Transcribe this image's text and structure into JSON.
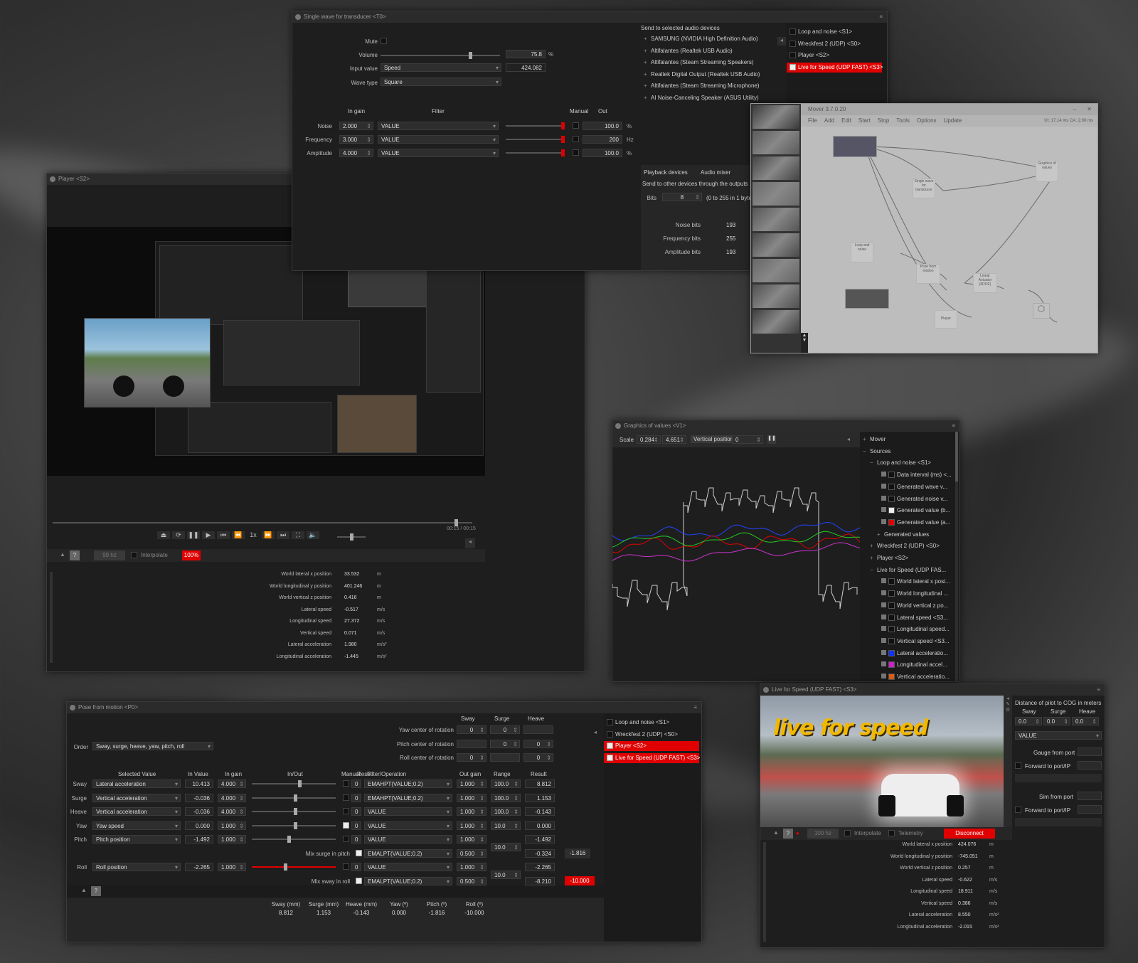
{
  "colors": {
    "accent_red": "#e10000",
    "panel": "#1e1e1e",
    "title": "#2b2b2b"
  },
  "wave": {
    "title": "Single wave for transducer <T0>",
    "mute": "Mute",
    "volume_label": "Volume",
    "volume_value": "75.8",
    "volume_unit": "%",
    "volume_level": 0.758,
    "input_label": "Input value",
    "input_value": "Speed",
    "input_readout": "424.082",
    "wavetype_label": "Wave type",
    "wavetype_value": "Square",
    "cols": {
      "ingain": "In gain",
      "filter": "Filter",
      "manual": "Manual",
      "out": "Out"
    },
    "rows": [
      {
        "label": "Noise",
        "gain": "2.000",
        "filter": "VALUE",
        "out": "100.0",
        "unit": "%"
      },
      {
        "label": "Frequency",
        "gain": "3.000",
        "filter": "VALUE",
        "out": "200",
        "unit": "Hz"
      },
      {
        "label": "Amplitude",
        "gain": "4.000",
        "filter": "VALUE",
        "out": "100.0",
        "unit": "%"
      }
    ],
    "send_title": "Send to selected audio devices",
    "devices": [
      "SAMSUNG (NVIDIA High Definition Audio)",
      "Altifalantes (Realtek USB Audio)",
      "Altifalantes (Steam Streaming Speakers)",
      "Realtek Digital Output (Realtek USB Audio)",
      "Altifalantes (Steam Streaming Microphone)",
      "AI Noise-Canceling Speaker (ASUS Utility)"
    ],
    "tabs": [
      "Playback devices",
      "Audio mixer"
    ],
    "send_other": "Send to other devices through the outputs",
    "bits_label": "Bits",
    "bits_value": "8",
    "bits_hint": "(0 to 255 in 1 byte)",
    "bitrows": [
      {
        "label": "Noise bits",
        "value": "193"
      },
      {
        "label": "Frequency bits",
        "value": "255"
      },
      {
        "label": "Amplitude bits",
        "value": "193"
      }
    ],
    "sources": [
      "Loop and noise <S1>",
      "Wreckfest 2 (UDP) <S0>",
      "Player <S2>",
      "Live for Speed (UDP FAST) <S3>"
    ]
  },
  "player": {
    "title": "Player <S2>",
    "hz": "99 hz",
    "interpolate": "Interpolate",
    "pct": "100%",
    "time": "00:15 / 00:15",
    "stats": [
      {
        "label": "World lateral x position",
        "value": "33.532",
        "unit": "m"
      },
      {
        "label": "World longitudinal y position",
        "value": "401.246",
        "unit": "m"
      },
      {
        "label": "World vertical z position",
        "value": "0.416",
        "unit": "m"
      },
      {
        "label": "Lateral speed",
        "value": "-0.517",
        "unit": "m/s"
      },
      {
        "label": "Longitudinal speed",
        "value": "27.372",
        "unit": "m/s"
      },
      {
        "label": "Vertical speed",
        "value": "0.071",
        "unit": "m/s"
      },
      {
        "label": "Lateral acceleration",
        "value": "1.980",
        "unit": "m/s²"
      },
      {
        "label": "Longitudinal acceleration",
        "value": "-1.445",
        "unit": "m/s²"
      }
    ]
  },
  "mover": {
    "title": "Mover 3.7.0.20",
    "menu": [
      "File",
      "Add",
      "Edit",
      "Start",
      "Stop",
      "Tools",
      "Options",
      "Update"
    ],
    "status": "Ut: 17.14 ms  CA: 2.00 ms",
    "nodes": [
      "Single wave for transducer",
      "Graphics of values",
      "Loop and noise",
      "Pose from motion",
      "Linear Actuator (6DOF)",
      "Player"
    ]
  },
  "graph": {
    "title": "Graphics of values <V1>",
    "scale_label": "Scale",
    "scale_a": "0.284",
    "scale_b": "4.651",
    "vpos_label": "Vertical position",
    "vpos_value": "0",
    "tree": [
      {
        "text": "Mover",
        "lvl": 0,
        "sign": "+"
      },
      {
        "text": "Sources",
        "lvl": 0,
        "sign": "−"
      },
      {
        "text": "Loop and noise <S1>",
        "lvl": 1,
        "sign": "−"
      },
      {
        "text": "Data interval (ms) <...",
        "lvl": 2,
        "color": "#111"
      },
      {
        "text": "Generated wave v...",
        "lvl": 2,
        "color": "#111"
      },
      {
        "text": "Generated noise v...",
        "lvl": 2,
        "color": "#111"
      },
      {
        "text": "Generated value (b...",
        "lvl": 2,
        "color": "#eeeeee"
      },
      {
        "text": "Generated value (a...",
        "lvl": 2,
        "color": "#e10000"
      },
      {
        "text": "Generated values",
        "lvl": 2,
        "sign": "+"
      },
      {
        "text": "Wreckfest 2 (UDP) <S0>",
        "lvl": 1,
        "sign": "+"
      },
      {
        "text": "Player <S2>",
        "lvl": 1,
        "sign": "+"
      },
      {
        "text": "Live for Speed (UDP FAS...",
        "lvl": 1,
        "sign": "−"
      },
      {
        "text": "World lateral x posi...",
        "lvl": 2,
        "color": "#111"
      },
      {
        "text": "World longitudinal ...",
        "lvl": 2,
        "color": "#111"
      },
      {
        "text": "World vertical z po...",
        "lvl": 2,
        "color": "#111"
      },
      {
        "text": "Lateral speed <S3...",
        "lvl": 2,
        "color": "#111"
      },
      {
        "text": "Longitudinal speed...",
        "lvl": 2,
        "color": "#111"
      },
      {
        "text": "Vertical speed <S3...",
        "lvl": 2,
        "color": "#111"
      },
      {
        "text": "Lateral acceleratio...",
        "lvl": 2,
        "color": "#1133ff"
      },
      {
        "text": "Longitudinal accel...",
        "lvl": 2,
        "color": "#cc22cc"
      },
      {
        "text": "Vertical acceleratio...",
        "lvl": 2,
        "color": "#e06010"
      }
    ]
  },
  "pose": {
    "title": "Pose from motion <P0>",
    "order_label": "Order",
    "order_value": "Sway, surge, heave, yaw, pitch, roll",
    "center_cols": [
      "Sway",
      "Surge",
      "Heave"
    ],
    "centers": [
      {
        "label": "Yaw center of rotation",
        "vals": [
          "0",
          "0",
          ""
        ]
      },
      {
        "label": "Pitch center of rotation",
        "vals": [
          "",
          "0",
          "0"
        ]
      },
      {
        "label": "Roll center of rotation",
        "vals": [
          "0",
          "",
          "0"
        ]
      }
    ],
    "cols": [
      "Selected Value",
      "In Value",
      "In gain",
      "In/Out",
      "Manual",
      "Reset",
      "Filter/Operation",
      "Out gain",
      "Range",
      "Result"
    ],
    "rows": [
      {
        "axis": "Sway",
        "sel": "Lateral acceleration",
        "inval": "10.413",
        "gain": "4.000",
        "reset": "0",
        "filter": "EMAHPT(VALUE;0.2)",
        "outgain": "1.000",
        "range": "100.0",
        "result": "8.812"
      },
      {
        "axis": "Surge",
        "sel": "Vertical acceleration",
        "inval": "-0.036",
        "gain": "4.000",
        "reset": "0",
        "filter": "EMAHPT(VALUE;0.2)",
        "outgain": "1.000",
        "range": "100.0",
        "result": "1.153"
      },
      {
        "axis": "Heave",
        "sel": "Vertical acceleration",
        "inval": "-0.036",
        "gain": "4.000",
        "reset": "0",
        "filter": "VALUE",
        "outgain": "1.000",
        "range": "100.0",
        "result": "-0.143"
      },
      {
        "axis": "Yaw",
        "sel": "Yaw speed",
        "inval": "0.000",
        "gain": "1.000",
        "reset": "0",
        "filter": "VALUE",
        "outgain": "1.000",
        "range": "10.0",
        "result": "0.000"
      },
      {
        "axis": "Pitch",
        "sel": "Pitch position",
        "inval": "-1.492",
        "gain": "1.000",
        "reset": "0",
        "filter": "VALUE",
        "outgain": "1.000",
        "range": "",
        "result": "-1.492"
      },
      {
        "axis": "",
        "sel": "Mix surge in pitch",
        "inval": "",
        "gain": "",
        "reset": "",
        "filter": "EMALPT(VALUE;0.2)",
        "outgain": "0.500",
        "range": "10.0",
        "result": "-0.324"
      },
      {
        "axis": "Roll",
        "sel": "Roll position",
        "inval": "-2.265",
        "gain": "1.000",
        "reset": "0",
        "filter": "VALUE",
        "outgain": "1.000",
        "range": "",
        "result": "-2.265"
      },
      {
        "axis": "",
        "sel": "Mix sway in roll",
        "inval": "",
        "gain": "",
        "reset": "",
        "filter": "EMALPT(VALUE;0.2)",
        "outgain": "0.500",
        "range": "10.0",
        "result": "-8.210"
      }
    ],
    "pitch_total": "-1.816",
    "roll_total": "-10.000",
    "sources": [
      "Loop and noise <S1>",
      "Wreckfest 2 (UDP) <S0>",
      "Player <S2>",
      "Live for Speed (UDP FAST) <S3>"
    ],
    "summary": [
      {
        "label": "Sway (mm)",
        "value": "8.812"
      },
      {
        "label": "Surge (mm)",
        "value": "1.153"
      },
      {
        "label": "Heave (mm)",
        "value": "-0.143"
      },
      {
        "label": "Yaw (º)",
        "value": "0.000"
      },
      {
        "label": "Pitch (º)",
        "value": "-1.816"
      },
      {
        "label": "Roll (º)",
        "value": "-10.000"
      }
    ]
  },
  "lfs": {
    "title": "Live for Speed (UDP FAST) <S3>",
    "logo": "live for speed",
    "cog_title": "Distance of pilot to COG in meters",
    "cog_cols": [
      "Sway",
      "Surge",
      "Heave"
    ],
    "cog_vals": [
      "0.0",
      "0.0",
      "0.0"
    ],
    "value_dd": "VALUE",
    "gauge": "Gauge  from port",
    "forward": "Forward to port/IP",
    "sim": "Sim  from port",
    "forward2": "Forward to port/IP",
    "hz": "100 hz",
    "interpolate": "Interpolate",
    "telemetry": "Telemetry",
    "disconnect": "Disconnect",
    "stats": [
      {
        "label": "World lateral x position",
        "value": "424.076",
        "unit": "m"
      },
      {
        "label": "World longitudinal y position",
        "value": "-745.051",
        "unit": "m"
      },
      {
        "label": "World vertical z position",
        "value": "0.257",
        "unit": "m"
      },
      {
        "label": "Lateral speed",
        "value": "-0.622",
        "unit": "m/s"
      },
      {
        "label": "Longitudinal speed",
        "value": "18.911",
        "unit": "m/s"
      },
      {
        "label": "Vertical speed",
        "value": "0.386",
        "unit": "m/s"
      },
      {
        "label": "Lateral acceleration",
        "value": "8.550",
        "unit": "m/s²"
      },
      {
        "label": "Longitudinal acceleration",
        "value": "-2.015",
        "unit": "m/s²"
      }
    ]
  }
}
